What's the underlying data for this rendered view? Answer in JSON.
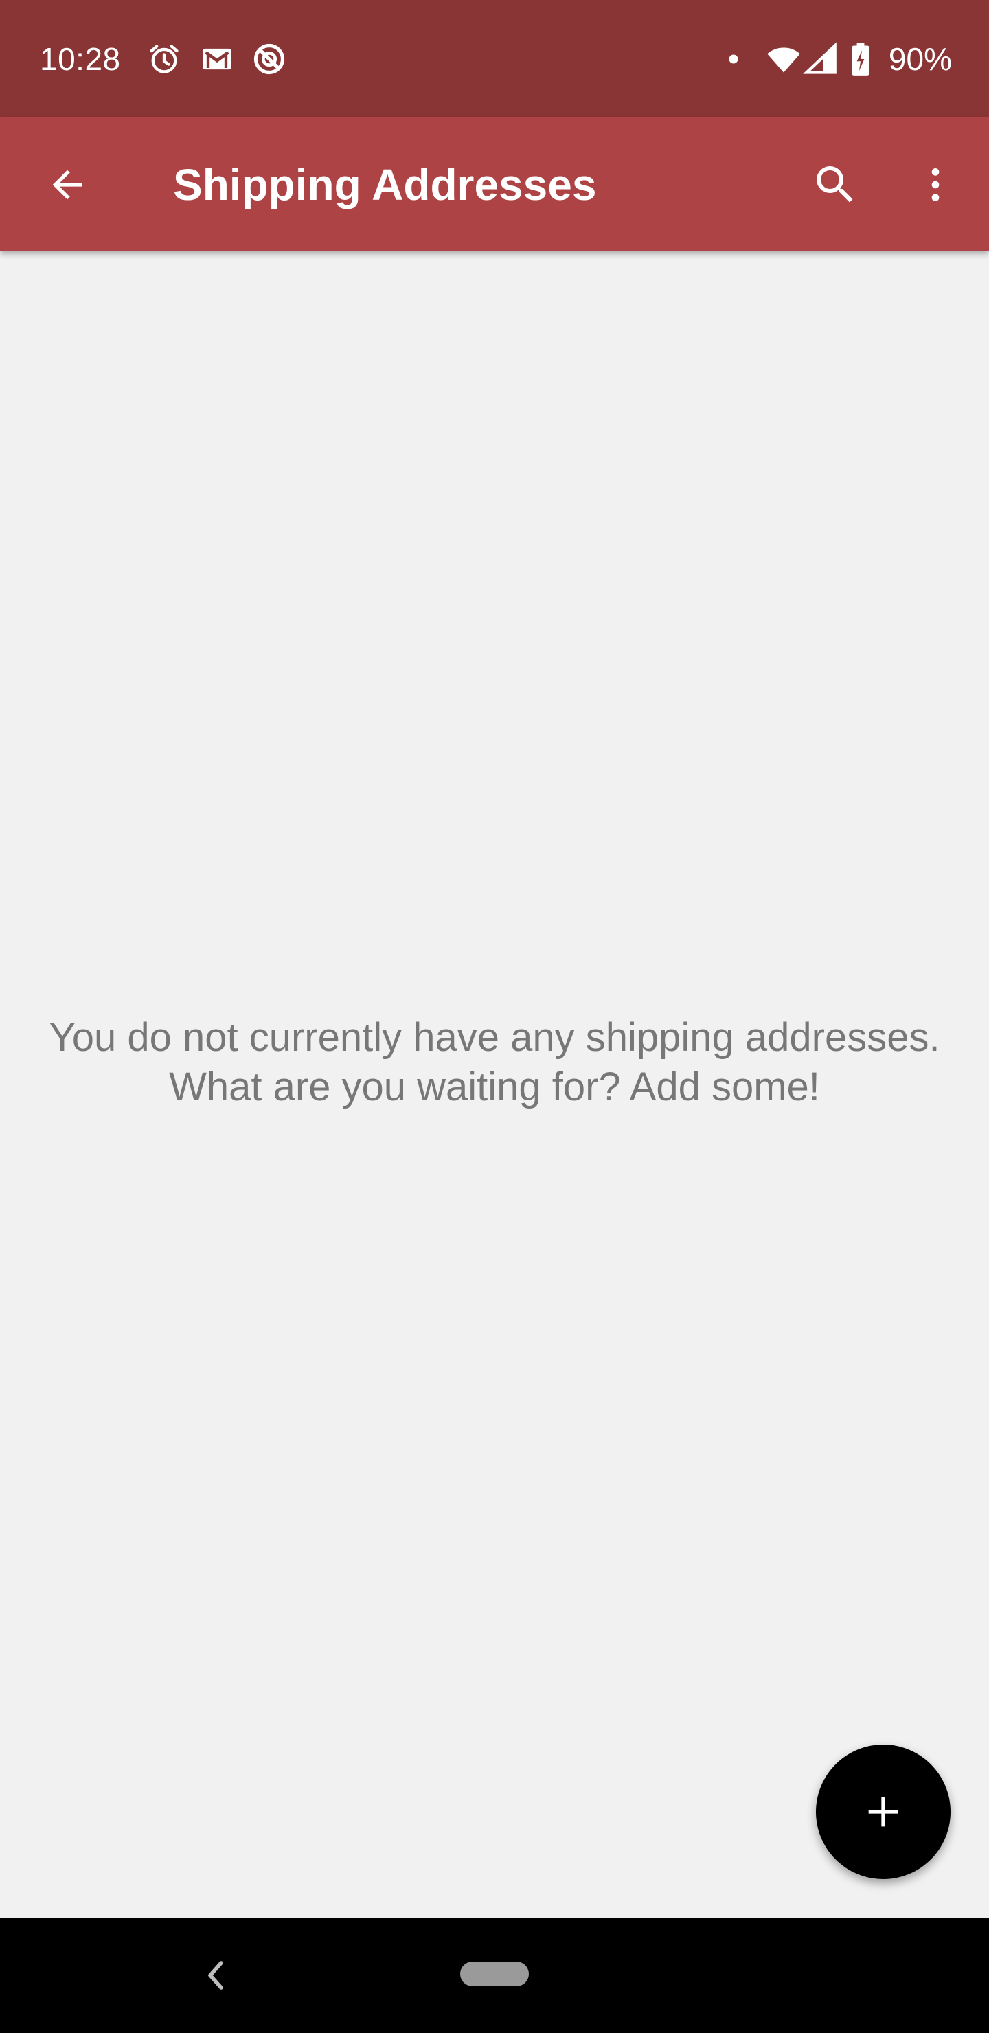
{
  "status_bar": {
    "time": "10:28",
    "battery_percent": "90%",
    "icons": [
      "alarm-icon",
      "gmail-icon",
      "do-not-disturb-icon",
      "notification-dot-icon",
      "wifi-icon",
      "signal-icon",
      "battery-charging-icon"
    ]
  },
  "app_bar": {
    "title": "Shipping Addresses",
    "background_color": "#ad4344",
    "icons": [
      "back-arrow-icon",
      "search-icon",
      "more-vert-icon"
    ]
  },
  "empty_state": {
    "line1": "You do not currently have any shipping addresses.",
    "line2": "What are you waiting for? Add some!"
  },
  "fab": {
    "icon": "add-icon"
  },
  "nav_bar": {
    "icons": [
      "nav-back-icon",
      "home-pill"
    ]
  },
  "colors": {
    "status_bar": "#8a3535",
    "app_bar": "#ad4344",
    "background": "#f1f1f1",
    "empty_text": "#777777",
    "fab": "#000000"
  }
}
